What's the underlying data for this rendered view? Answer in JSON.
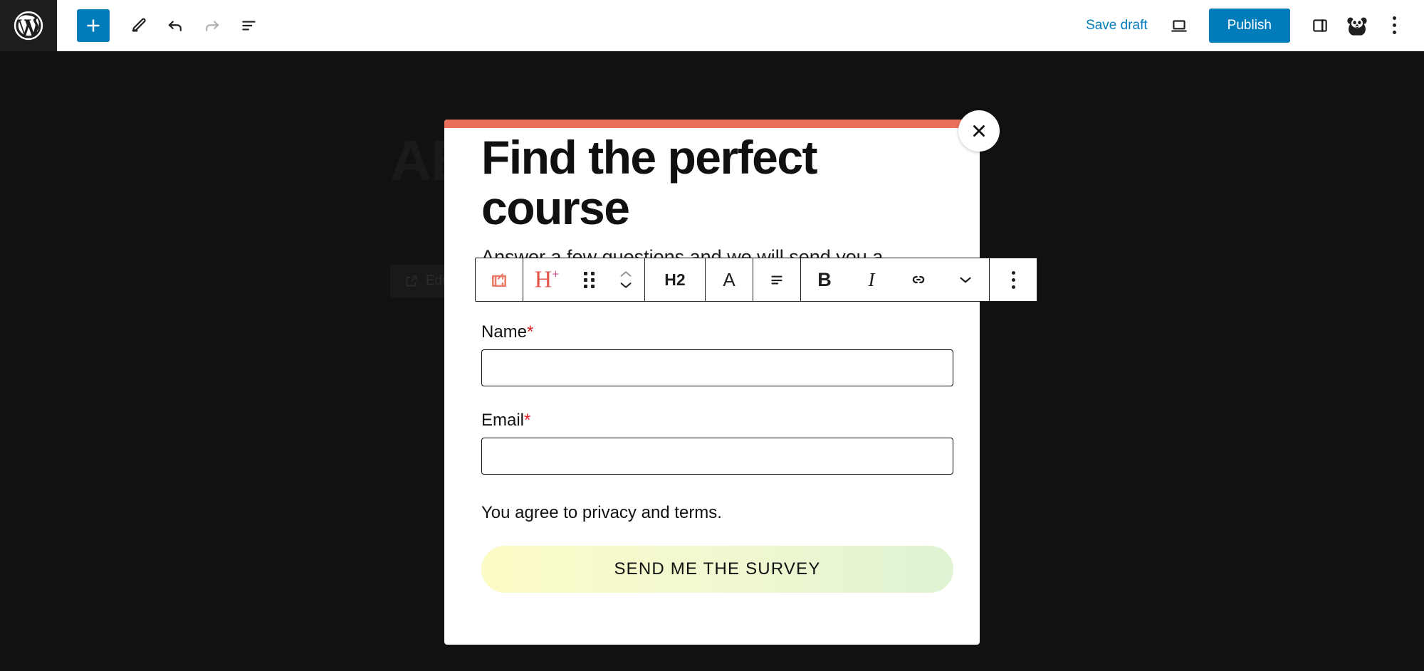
{
  "editor": {
    "logo_icon": "wordpress-logo-icon",
    "left_tools": [
      {
        "name": "add-block-button",
        "icon": "plus-icon",
        "label": ""
      },
      {
        "name": "tools-button",
        "icon": "pencil-icon",
        "label": ""
      },
      {
        "name": "undo-button",
        "icon": "undo-arrow-icon",
        "label": ""
      },
      {
        "name": "redo-button",
        "icon": "redo-arrow-icon",
        "label": "",
        "disabled": true
      },
      {
        "name": "document-overview-button",
        "icon": "list-view-icon",
        "label": ""
      }
    ],
    "save_draft_label": "Save draft",
    "preview_icon": "laptop-preview-icon",
    "publish_label": "Publish",
    "settings_icon": "sidebar-panel-icon",
    "avatar_icon": "panda-avatar-icon",
    "options_icon": "kebab-menu-icon",
    "accent_color": "#007cba",
    "chrome_dark": "#1e1e1e"
  },
  "block_toolbar": {
    "parent_block_icon": "popup-external-link-icon",
    "parent_block_color": "#ec7b6a",
    "block_type_icon": "heading-plus-icon",
    "block_type_color": "#e2574c",
    "drag_handle_icon": "drag-handle-dots-icon",
    "move_up_icon": "chevron-up-icon",
    "move_down_icon": "chevron-down-icon",
    "heading_level_label": "H2",
    "text_color_label": "A",
    "align_icon": "align-text-icon",
    "bold_label": "B",
    "italic_label": "I",
    "link_icon": "link-icon",
    "more_rich_text_icon": "chevron-down-icon",
    "options_icon": "kebab-menu-icon"
  },
  "canvas": {
    "site_heading": "ABOUT",
    "edit_chip_label": "Edit",
    "edit_chip_icon": "external-link-icon",
    "background_color": "#111111"
  },
  "popup": {
    "accent_bar_color": "#e8705a",
    "close_icon": "close-x-icon",
    "title": "Find the perfect course",
    "subtitle": "Answer a few questions and we will send you a personalized list of courses that match your goals.",
    "fields": [
      {
        "label": "Name",
        "required_marker": "*",
        "value": "",
        "placeholder": ""
      },
      {
        "label": "Email",
        "required_marker": "*",
        "value": "",
        "placeholder": ""
      }
    ],
    "privacy_text": "You agree to privacy and terms.",
    "submit_label": "SEND ME THE SURVEY",
    "submit_gradient_from": "#fbfbc6",
    "submit_gradient_to": "#dff4d4"
  }
}
